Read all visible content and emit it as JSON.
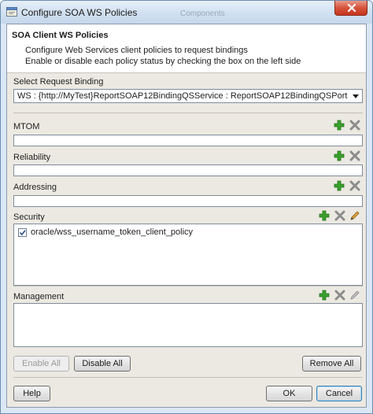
{
  "window": {
    "title": "Configure SOA WS Policies",
    "background_hint": "Components",
    "icon": "dialog-icon"
  },
  "header": {
    "title": "SOA Client WS Policies",
    "line1": "Configure Web Services client policies to request bindings",
    "line2": "Enable or disable each policy status by checking the box on the left side"
  },
  "binding": {
    "label": "Select Request Binding",
    "selected": "WS : {http://MyTest}ReportSOAP12BindingQSService : ReportSOAP12BindingQSPort"
  },
  "sections": {
    "mtom": {
      "label": "MTOM",
      "value": ""
    },
    "reliability": {
      "label": "Reliability",
      "value": ""
    },
    "addressing": {
      "label": "Addressing",
      "value": ""
    },
    "security": {
      "label": "Security",
      "items": [
        {
          "checked": true,
          "name": "oracle/wss_username_token_client_policy"
        }
      ]
    },
    "management": {
      "label": "Management",
      "items": []
    }
  },
  "buttons": {
    "enable_all": "Enable All",
    "disable_all": "Disable All",
    "remove_all": "Remove All",
    "help": "Help",
    "ok": "OK",
    "cancel": "Cancel"
  },
  "colors": {
    "add_icon": "#3aa02c",
    "remove_icon": "#8c8c8c",
    "edit_icon": "#c98a1e",
    "window_frame": "#dbe7f4",
    "close_button": "#d6533a",
    "content_bg": "#ece9e2"
  }
}
